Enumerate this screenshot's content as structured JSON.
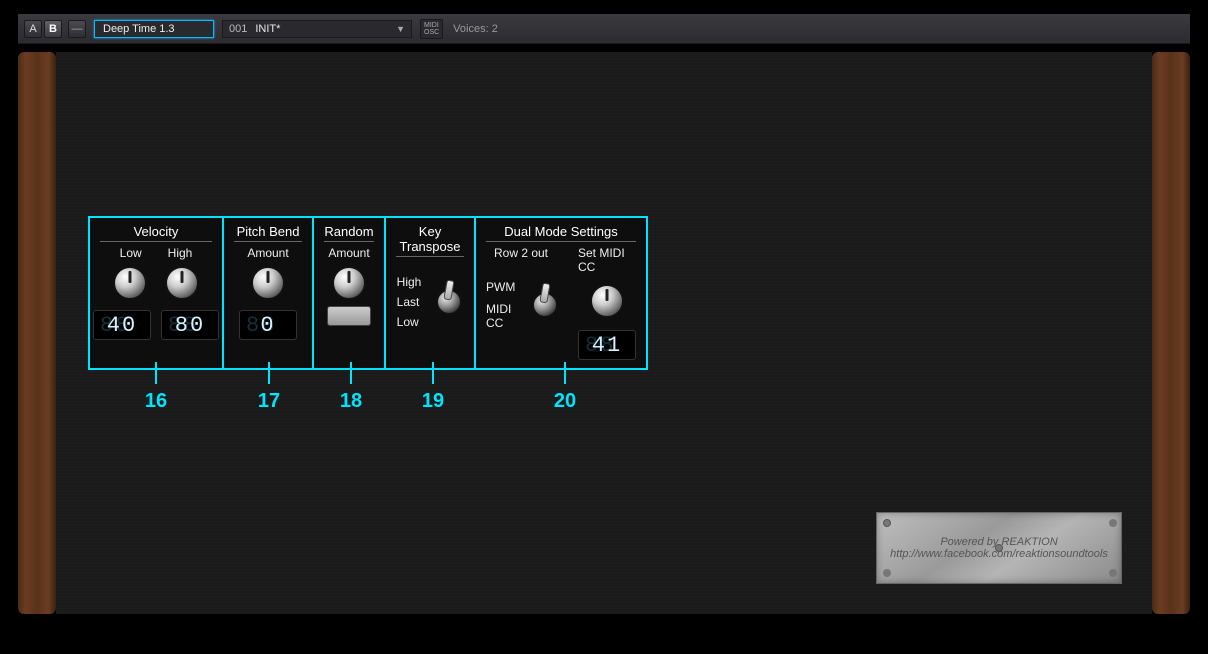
{
  "topbar": {
    "a_label": "A",
    "b_label": "B",
    "minus": "—",
    "preset_name": "Deep Time 1.3",
    "preset_number": "001",
    "preset_label": "INIT*",
    "midi_osc_line1": "MIDI",
    "midi_osc_line2": "OSC",
    "voices_label": "Voices:",
    "voices_count": "2"
  },
  "sections": {
    "velocity": {
      "title": "Velocity",
      "low_label": "Low",
      "high_label": "High",
      "low_value": "40",
      "high_value": "80"
    },
    "pitchbend": {
      "title": "Pitch Bend",
      "amount_label": "Amount",
      "value": "0"
    },
    "random": {
      "title": "Random",
      "amount_label": "Amount"
    },
    "keytranspose": {
      "title": "Key Transpose",
      "high": "High",
      "last": "Last",
      "low": "Low"
    },
    "dual": {
      "title": "Dual Mode Settings",
      "row2out": "Row 2 out",
      "setmidicc": "Set MIDI CC",
      "pwm": "PWM",
      "midicc": "MIDI CC",
      "cc_value": "41"
    }
  },
  "callouts": {
    "c16": "16",
    "c17": "17",
    "c18": "18",
    "c19": "19",
    "c20": "20"
  },
  "plaque": {
    "line1": "Powered by REAKTION",
    "line2": "http://www.facebook.com/reaktionsoundtools"
  }
}
